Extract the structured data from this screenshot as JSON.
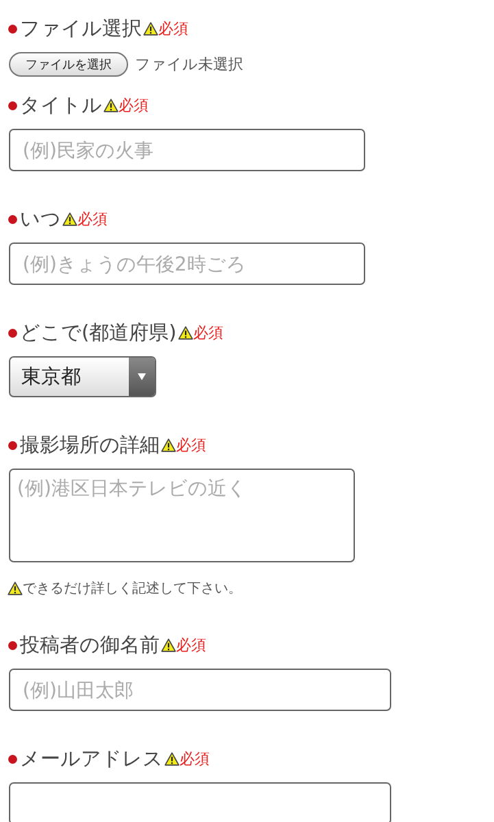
{
  "fields": [
    {
      "kind": "file",
      "label": "ファイル選択",
      "required": true,
      "required_text": "必須",
      "button": "ファイルを選択",
      "status": "ファイル未選択"
    },
    {
      "kind": "text",
      "label": "タイトル",
      "required": true,
      "required_text": "必須",
      "placeholder": "(例)民家の火事"
    },
    {
      "kind": "text",
      "label": "いつ",
      "required": true,
      "required_text": "必須",
      "placeholder": "(例)きょうの午後2時ごろ"
    },
    {
      "kind": "select",
      "label": "どこで(都道府県)",
      "required": true,
      "required_text": "必須",
      "value": "東京都"
    },
    {
      "kind": "textarea",
      "label": "撮影場所の詳細",
      "required": true,
      "required_text": "必須",
      "placeholder": "(例)港区日本テレビの近く",
      "note": "できるだけ詳しく記述して下さい。"
    },
    {
      "kind": "text",
      "label": "投稿者の御名前",
      "required": true,
      "required_text": "必須",
      "placeholder": "(例)山田太郎"
    },
    {
      "kind": "text",
      "label": "メールアドレス",
      "required": true,
      "required_text": "必須"
    }
  ]
}
